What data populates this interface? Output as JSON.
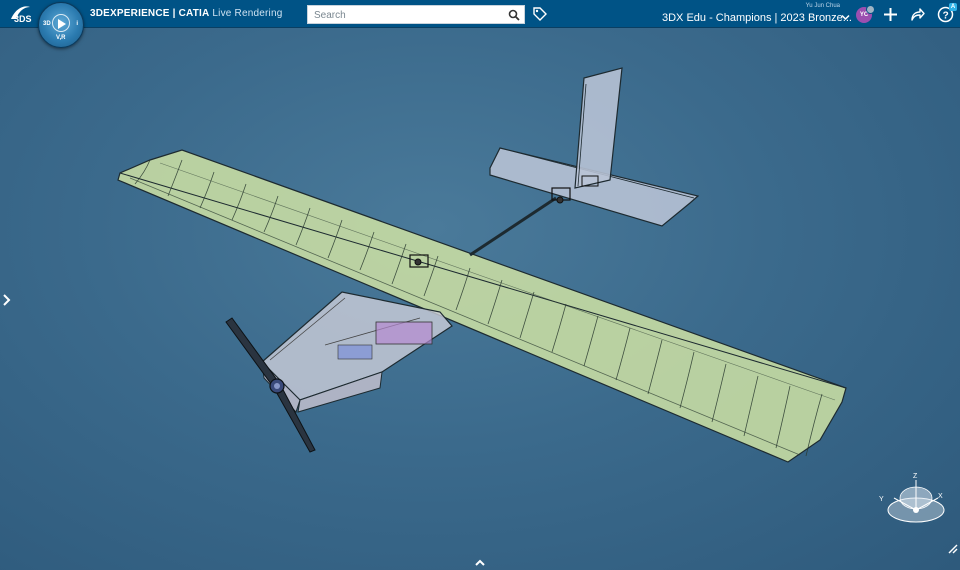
{
  "header": {
    "brand": "3DS",
    "compass": {
      "top": "",
      "left": "3D",
      "right": "i",
      "bottom": "V,R"
    },
    "app_name_strong": "3DEXPERIENCE | CATIA",
    "app_name_light": "Live Rendering",
    "search": {
      "placeholder": "Search",
      "value": ""
    },
    "user_name": "Yu Jun Chua",
    "workspace": "3DX Edu - Champions | 2023 Bronze...",
    "avatar_initials": "YC",
    "help_badge": "A"
  },
  "viewport": {
    "background_color": "#3b6a8c",
    "triad_axes": {
      "x": "X",
      "y": "Y",
      "z": "Z"
    }
  },
  "colors": {
    "topbar": "#005386",
    "accent": "#2fb3e8",
    "wing_fill": "#c7dca3",
    "fuselage_fill": "#c9ccd8",
    "servo_purple": "#b58ad0"
  }
}
